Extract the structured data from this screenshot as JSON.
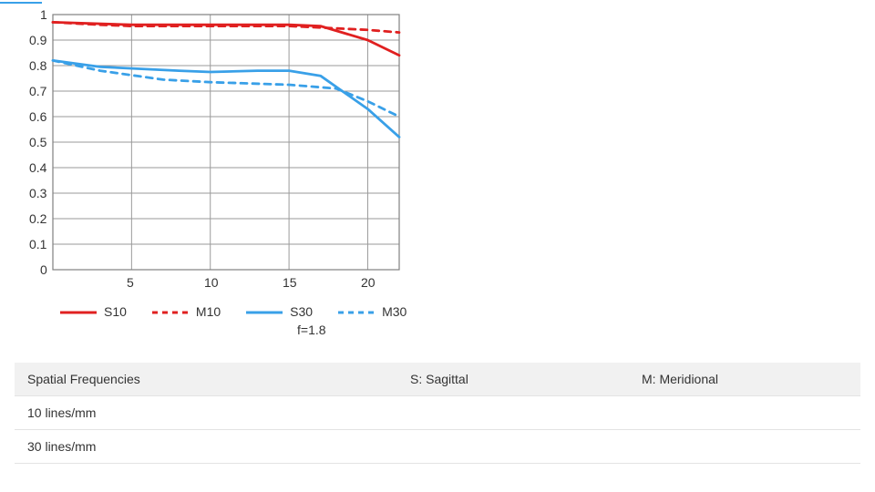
{
  "chart_data": {
    "type": "line",
    "xlabel": "",
    "ylabel": "",
    "xlim": [
      0,
      22
    ],
    "ylim": [
      0,
      1
    ],
    "x_ticks": [
      5,
      10,
      15,
      20
    ],
    "y_ticks": [
      0,
      0.1,
      0.2,
      0.3,
      0.4,
      0.5,
      0.6,
      0.7,
      0.8,
      0.9,
      1
    ],
    "caption": "f=1.8",
    "legend": {
      "items": [
        "S10",
        "M10",
        "S30",
        "M30"
      ],
      "position": "bottom"
    },
    "series": [
      {
        "name": "S10",
        "color": "#e02020",
        "style": "solid",
        "x": [
          0,
          5,
          10,
          15,
          17,
          20,
          22
        ],
        "y": [
          0.97,
          0.96,
          0.96,
          0.96,
          0.955,
          0.9,
          0.84
        ]
      },
      {
        "name": "M10",
        "color": "#e02020",
        "style": "dashed",
        "x": [
          0,
          3,
          5,
          10,
          15,
          20,
          22
        ],
        "y": [
          0.97,
          0.96,
          0.955,
          0.955,
          0.955,
          0.94,
          0.93
        ]
      },
      {
        "name": "S30",
        "color": "#39a0e8",
        "style": "solid",
        "x": [
          0,
          3,
          8,
          10,
          13,
          15,
          17,
          20,
          22
        ],
        "y": [
          0.82,
          0.795,
          0.78,
          0.775,
          0.78,
          0.78,
          0.76,
          0.63,
          0.52
        ]
      },
      {
        "name": "M30",
        "color": "#39a0e8",
        "style": "dashed",
        "x": [
          0,
          3,
          7,
          10,
          15,
          18,
          20,
          22
        ],
        "y": [
          0.82,
          0.78,
          0.745,
          0.735,
          0.725,
          0.71,
          0.66,
          0.6
        ]
      }
    ]
  },
  "table": {
    "header": {
      "c1": "Spatial Frequencies",
      "c2": "S: Sagittal",
      "c3": "M: Meridional"
    },
    "rows": [
      {
        "label": "10 lines/mm",
        "color": "#e02020"
      },
      {
        "label": "30 lines/mm",
        "color": "#39a0e8"
      }
    ]
  }
}
